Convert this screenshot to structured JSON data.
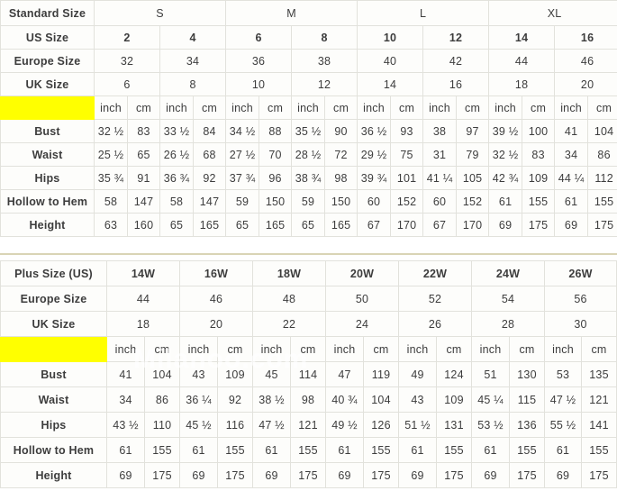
{
  "standard_table": {
    "group_header": {
      "label": "Standard Size",
      "groups": [
        {
          "name": "S",
          "span": 2
        },
        {
          "name": "M",
          "span": 2
        },
        {
          "name": "L",
          "span": 2
        },
        {
          "name": "XL",
          "span": 2
        }
      ]
    },
    "rows": [
      {
        "label": "US Size",
        "bold": true,
        "values": [
          "2",
          "4",
          "6",
          "8",
          "10",
          "12",
          "14",
          "16"
        ]
      },
      {
        "label": "Europe Size",
        "bold": false,
        "values": [
          "32",
          "34",
          "36",
          "38",
          "40",
          "42",
          "44",
          "46"
        ]
      },
      {
        "label": "UK Size",
        "bold": false,
        "values": [
          "6",
          "8",
          "10",
          "12",
          "14",
          "16",
          "18",
          "20"
        ]
      }
    ],
    "unit_row": {
      "label": "",
      "units": [
        "inch",
        "cm",
        "inch",
        "cm",
        "inch",
        "cm",
        "inch",
        "cm",
        "inch",
        "cm",
        "inch",
        "cm",
        "inch",
        "cm",
        "inch",
        "cm"
      ]
    },
    "measure_rows": [
      {
        "label": "Bust",
        "values": [
          "32 ½",
          "83",
          "33 ½",
          "84",
          "34 ½",
          "88",
          "35 ½",
          "90",
          "36 ½",
          "93",
          "38",
          "97",
          "39 ½",
          "100",
          "41",
          "104"
        ]
      },
      {
        "label": "Waist",
        "values": [
          "25 ½",
          "65",
          "26 ½",
          "68",
          "27 ½",
          "70",
          "28 ½",
          "72",
          "29 ½",
          "75",
          "31",
          "79",
          "32 ½",
          "83",
          "34",
          "86"
        ]
      },
      {
        "label": "Hips",
        "values": [
          "35 ¾",
          "91",
          "36 ¾",
          "92",
          "37 ¾",
          "96",
          "38 ¾",
          "98",
          "39 ¾",
          "101",
          "41 ¼",
          "105",
          "42 ¾",
          "109",
          "44 ¼",
          "112"
        ]
      },
      {
        "label": "Hollow to Hem",
        "values": [
          "58",
          "147",
          "58",
          "147",
          "59",
          "150",
          "59",
          "150",
          "60",
          "152",
          "60",
          "152",
          "61",
          "155",
          "61",
          "155"
        ]
      },
      {
        "label": "Height",
        "values": [
          "63",
          "160",
          "65",
          "165",
          "65",
          "165",
          "65",
          "165",
          "67",
          "170",
          "67",
          "170",
          "69",
          "175",
          "69",
          "175"
        ]
      }
    ]
  },
  "plus_table": {
    "header_row": {
      "label": "Plus Size (US)",
      "values": [
        "14W",
        "16W",
        "18W",
        "20W",
        "22W",
        "24W",
        "26W"
      ]
    },
    "rows": [
      {
        "label": "Europe Size",
        "values": [
          "44",
          "46",
          "48",
          "50",
          "52",
          "54",
          "56"
        ]
      },
      {
        "label": "UK Size",
        "values": [
          "18",
          "20",
          "22",
          "24",
          "26",
          "28",
          "30"
        ]
      }
    ],
    "unit_row": {
      "label": "",
      "units": [
        "inch",
        "cm",
        "inch",
        "cm",
        "inch",
        "cm",
        "inch",
        "cm",
        "inch",
        "cm",
        "inch",
        "cm",
        "inch",
        "cm"
      ]
    },
    "measure_rows": [
      {
        "label": "Bust",
        "values": [
          "41",
          "104",
          "43",
          "109",
          "45",
          "114",
          "47",
          "119",
          "49",
          "124",
          "51",
          "130",
          "53",
          "135"
        ]
      },
      {
        "label": "Waist",
        "values": [
          "34",
          "86",
          "36 ¼",
          "92",
          "38 ½",
          "98",
          "40 ¾",
          "104",
          "43",
          "109",
          "45 ¼",
          "115",
          "47 ½",
          "121"
        ]
      },
      {
        "label": "Hips",
        "values": [
          "43 ½",
          "110",
          "45 ½",
          "116",
          "47 ½",
          "121",
          "49 ½",
          "126",
          "51 ½",
          "131",
          "53 ½",
          "136",
          "55 ½",
          "141"
        ]
      },
      {
        "label": "Hollow to Hem",
        "values": [
          "61",
          "155",
          "61",
          "155",
          "61",
          "155",
          "61",
          "155",
          "61",
          "155",
          "61",
          "155",
          "61",
          "155"
        ]
      },
      {
        "label": "Height",
        "values": [
          "69",
          "175",
          "69",
          "175",
          "69",
          "175",
          "69",
          "175",
          "69",
          "175",
          "69",
          "175",
          "69",
          "175"
        ]
      }
    ]
  },
  "watermark": {
    "text": "Milanoo.com"
  },
  "colors": {
    "label_bg": "#ffff00",
    "label_text": "#584b10",
    "group_bg": "#00f0f8",
    "group_text": "#16b9c6",
    "cell_bg": "#fdfdfb",
    "cell_text": "#3d3d3d",
    "grid": "#e2e2dc"
  }
}
